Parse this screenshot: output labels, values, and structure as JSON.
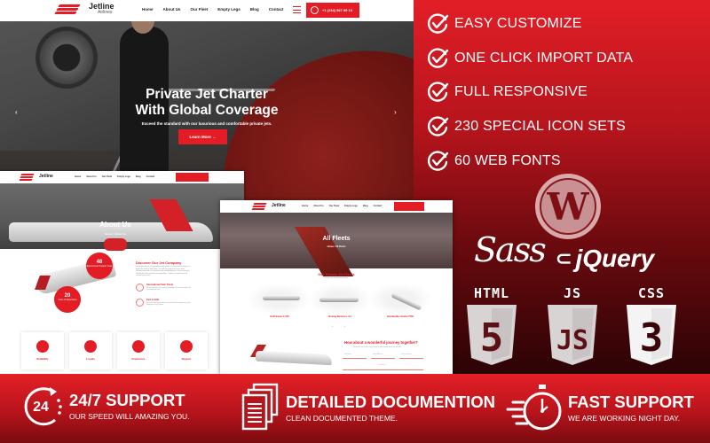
{
  "colors": {
    "brand": "#e31c25",
    "dark_red": "#6a0a0e",
    "white": "#ffffff"
  },
  "hero_site": {
    "logo": {
      "name": "Jetline",
      "sub": "Airlines"
    },
    "nav": [
      "Home",
      "About Us",
      "Our Fleet",
      "Empty Legs",
      "Blog",
      "Contact"
    ],
    "phone": "+1 (234) 567 89 10",
    "title_line1": "Private Jet Charter",
    "title_line2": "With Global Coverage",
    "subtitle": "Exceed the standard with our luxurious and comfortable private jets.",
    "cta": "Learn More →",
    "prev": "‹",
    "next": "›"
  },
  "about_site": {
    "logo": {
      "name": "Jetline"
    },
    "nav": [
      "Home",
      "About Us",
      "Our Fleet",
      "Empty Legs",
      "Blog",
      "Contact"
    ],
    "title": "About Us",
    "breadcrumb": "Home  /  About Us",
    "badge1": {
      "num": "48",
      "label": "Experienced Support Crew"
    },
    "badge2": {
      "num": "20",
      "label": "Years of Experience"
    },
    "discover_title": "Discover Our Jet Company",
    "discover_text": "For professionals, we provide private plane charters so that they can make the most of their time. You will see your time in the most efficient way with our luxurious and comfortable jets. Our private jets will provide fast and safe transportation. Contact us now and we'll reserve your place.",
    "features": [
      {
        "title": "International Safe Travel",
        "text": "We perform safe and comfortable flights all over the world with our competent crew."
      },
      {
        "title": "Fast & Safe",
        "text": "We make fast flights with our advanced technology, extra safe equipment, large planes."
      }
    ],
    "cards": [
      "Reliability",
      "Loyalty",
      "Experience",
      "Support"
    ]
  },
  "fleet_site": {
    "logo": {
      "name": "Jetline"
    },
    "nav": [
      "Home",
      "About Us",
      "Our Fleet",
      "Empty Legs",
      "Blog",
      "Contact"
    ],
    "title": "All Fleets",
    "breadcrumb": "Home  /  All Fleets",
    "section_title": "Our Private Jet Fleets",
    "section_sub": "Discover our state-of-the-art fleets",
    "jets": [
      "Gulfstream G-550",
      "Boeing Business Jet",
      "Bombardier Global 7500"
    ],
    "carousel": "‹ ›",
    "journey_title": "How about a wonderful journey together?",
    "journey_sub": "Please fill out the form to get detailed information about aircraft fleet",
    "inputs": [
      "Full Name",
      "Email Address",
      "Phone Number"
    ],
    "submit": "Get Back →"
  },
  "features": [
    "EASY CUSTOMIZE",
    "ONE CLICK IMPORT DATA",
    "FULL RESPONSIVE",
    "230 SPECIAL ICON SETS",
    "60 WEB FONTS"
  ],
  "tech": {
    "wordpress": "W",
    "sass": "Sass",
    "jquery": "jQuery",
    "shields": [
      {
        "label": "HTML",
        "glyph": "5"
      },
      {
        "label": "JS",
        "glyph": "JS"
      },
      {
        "label": "CSS",
        "glyph": "3"
      }
    ]
  },
  "bottom": [
    {
      "icon": "24",
      "title": "24/7 SUPPORT",
      "sub": "OUR SPEED WILL AMAZING YOU."
    },
    {
      "title": "DETAILED DOCUMENTION",
      "sub": "CLEAN DOCUMENTED THEME."
    },
    {
      "title": "FAST SUPPORT",
      "sub": "WE ARE WORKING NIGHT DAY."
    }
  ]
}
